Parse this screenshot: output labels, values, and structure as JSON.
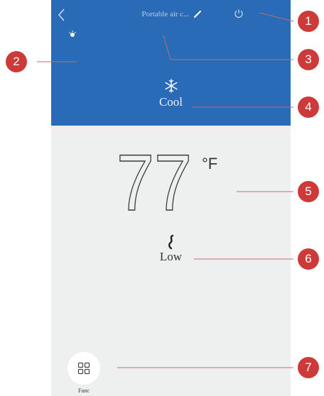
{
  "header": {
    "title": "Portable air c...",
    "background": "#2a6bb8"
  },
  "mode": {
    "icon": "snowflake-icon",
    "label": "Cool"
  },
  "temperature": {
    "value": "77",
    "unit": "°F"
  },
  "fan": {
    "icon": "fan-icon",
    "label": "Low"
  },
  "function_button": {
    "icon": "grid-icon",
    "label": "Func"
  },
  "callouts": [
    "1",
    "2",
    "3",
    "4",
    "5",
    "6",
    "7"
  ],
  "colors": {
    "callout": "#cc3b3a",
    "panel": "#eef0ef"
  }
}
